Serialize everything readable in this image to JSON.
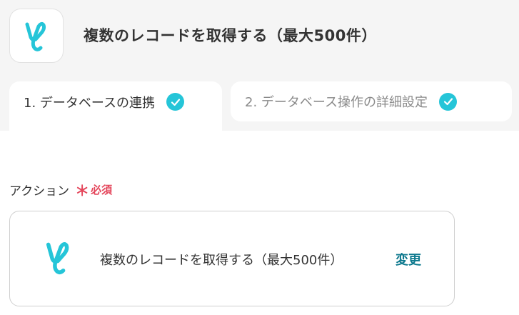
{
  "header": {
    "title": "複数のレコードを取得する（最大500件）",
    "logo_icon": "yoom-app-icon"
  },
  "tabs": [
    {
      "label": "1. データベースの連携",
      "completed": true,
      "active": true
    },
    {
      "label": "2. データベース操作の詳細設定",
      "completed": true,
      "active": false
    }
  ],
  "action_field": {
    "label": "アクション",
    "required_mark": "＊",
    "required_text": "必須",
    "selected_action": "複数のレコードを取得する（最大500件）",
    "change_label": "変更"
  },
  "colors": {
    "accent": "#25c5d8",
    "required": "#e4465b",
    "link": "#0f7a8f"
  }
}
